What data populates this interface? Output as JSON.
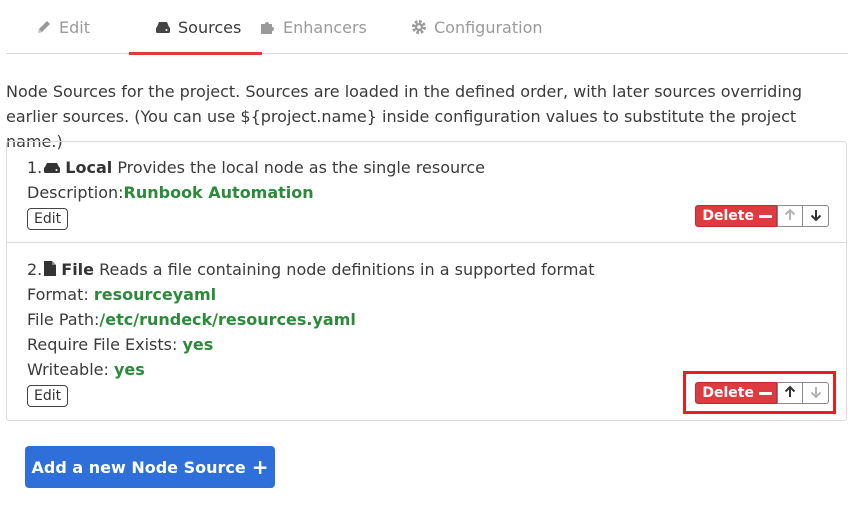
{
  "tabs": [
    {
      "label": "Edit",
      "icon": "pencil-icon"
    },
    {
      "label": "Sources",
      "icon": "drive-icon"
    },
    {
      "label": "Enhancers",
      "icon": "puzzle-icon"
    },
    {
      "label": "Configuration",
      "icon": "gear-icon"
    }
  ],
  "intro": "Node Sources for the project. Sources are loaded in the defined order, with later sources overriding earlier sources. (You can use ${project.name} inside configuration values to substitute the project name.)",
  "sources": [
    {
      "index": "1.",
      "name": "Local",
      "summary": "Provides the local node as the single resource",
      "props": [
        {
          "label": "Description:",
          "value": "Runbook Automation"
        }
      ],
      "edit_label": "Edit",
      "delete_label": "Delete"
    },
    {
      "index": "2.",
      "name": "File",
      "summary": "Reads a file containing node definitions in a supported format",
      "props": [
        {
          "label": "Format: ",
          "value": "resourceyaml"
        },
        {
          "label": "File Path:",
          "value": "/etc/rundeck/resources.yaml"
        },
        {
          "label": "Require File Exists: ",
          "value": "yes"
        },
        {
          "label": "Writeable: ",
          "value": "yes"
        }
      ],
      "edit_label": "Edit",
      "delete_label": "Delete"
    }
  ],
  "add_button_label": "Add a new Node Source",
  "colors": {
    "accent_red": "#de3a3f",
    "value_green": "#2c8a3a",
    "primary_blue": "#2e6fd9",
    "highlight": "#ee1c1c"
  }
}
